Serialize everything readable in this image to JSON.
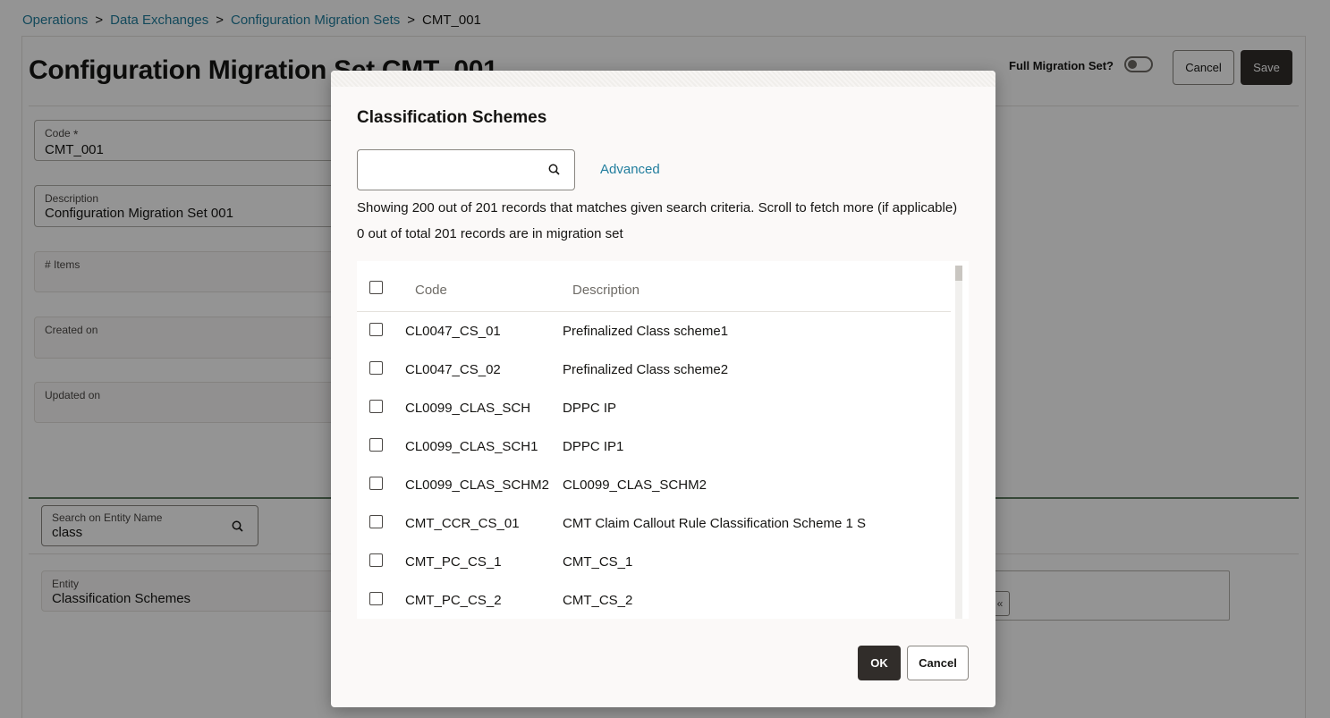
{
  "breadcrumb": {
    "items": [
      "Operations",
      "Data Exchanges",
      "Configuration Migration Sets"
    ],
    "separator": ">",
    "current": "CMT_001"
  },
  "page": {
    "title": "Configuration Migration Set CMT_001",
    "full_migration_label": "Full Migration Set?",
    "full_migration_on": false,
    "cancel_label": "Cancel",
    "save_label": "Save"
  },
  "form": {
    "code_label": "Code",
    "code_required": "*",
    "code_value": "CMT_001",
    "description_label": "Description",
    "description_value": "Configuration Migration Set 001",
    "items_label": "# Items",
    "created_label": "Created on",
    "updated_label": "Updated on"
  },
  "entity_search": {
    "label": "Search on Entity Name",
    "value": "class",
    "icon": "search-icon"
  },
  "entity": {
    "label": "Entity",
    "value": "Classification Schemes"
  },
  "right_box": {
    "mini_label": "«"
  },
  "dialog": {
    "title": "Classification Schemes",
    "search_value": "",
    "advanced_label": "Advanced",
    "info_showing": "Showing 200 out of 201 records that matches given search criteria. Scroll to fetch more (if applicable)",
    "info_selected": "0 out of total 201 records are in migration set",
    "columns": {
      "code": "Code",
      "description": "Description"
    },
    "rows": [
      {
        "code": "CL0047_CS_01",
        "description": "Prefinalized Class scheme1"
      },
      {
        "code": "CL0047_CS_02",
        "description": "Prefinalized Class scheme2"
      },
      {
        "code": "CL0099_CLAS_SCH",
        "description": "DPPC IP"
      },
      {
        "code": "CL0099_CLAS_SCH1",
        "description": "DPPC IP1"
      },
      {
        "code": "CL0099_CLAS_SCHM2",
        "description": "CL0099_CLAS_SCHM2"
      },
      {
        "code": "CMT_CCR_CS_01",
        "description": "CMT Claim Callout Rule Classification Scheme 1 S"
      },
      {
        "code": "CMT_PC_CS_1",
        "description": "CMT_CS_1"
      },
      {
        "code": "CMT_PC_CS_2",
        "description": "CMT_CS_2"
      }
    ],
    "ok_label": "OK",
    "cancel_label": "Cancel"
  },
  "colors": {
    "link": "#227e9e",
    "primary_button": "#312d2a",
    "accent_line": "#5d7a5f"
  }
}
